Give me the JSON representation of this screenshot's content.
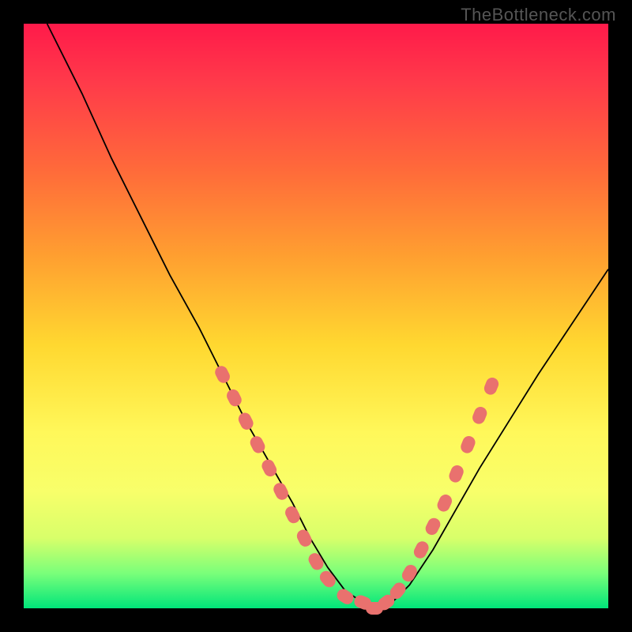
{
  "watermark": "TheBottleneck.com",
  "chart_data": {
    "type": "line",
    "title": "",
    "xlabel": "",
    "ylabel": "",
    "xlim": [
      0,
      100
    ],
    "ylim": [
      0,
      100
    ],
    "grid": false,
    "legend": false,
    "series": [
      {
        "name": "bottleneck-curve",
        "x": [
          4,
          10,
          15,
          20,
          25,
          30,
          34,
          38,
          42,
          46,
          49,
          52,
          55,
          58,
          60,
          63,
          66,
          70,
          74,
          78,
          83,
          88,
          94,
          100
        ],
        "y": [
          100,
          88,
          77,
          67,
          57,
          48,
          40,
          32,
          25,
          18,
          12,
          7,
          3,
          1,
          0,
          1,
          4,
          10,
          17,
          24,
          32,
          40,
          49,
          58
        ]
      }
    ],
    "markers": {
      "name": "highlighted-points",
      "points": [
        {
          "x": 34,
          "y": 40
        },
        {
          "x": 36,
          "y": 36
        },
        {
          "x": 38,
          "y": 32
        },
        {
          "x": 40,
          "y": 28
        },
        {
          "x": 42,
          "y": 24
        },
        {
          "x": 44,
          "y": 20
        },
        {
          "x": 46,
          "y": 16
        },
        {
          "x": 48,
          "y": 12
        },
        {
          "x": 50,
          "y": 8
        },
        {
          "x": 52,
          "y": 5
        },
        {
          "x": 55,
          "y": 2
        },
        {
          "x": 58,
          "y": 1
        },
        {
          "x": 60,
          "y": 0
        },
        {
          "x": 62,
          "y": 1
        },
        {
          "x": 64,
          "y": 3
        },
        {
          "x": 66,
          "y": 6
        },
        {
          "x": 68,
          "y": 10
        },
        {
          "x": 70,
          "y": 14
        },
        {
          "x": 72,
          "y": 18
        },
        {
          "x": 74,
          "y": 23
        },
        {
          "x": 76,
          "y": 28
        },
        {
          "x": 78,
          "y": 33
        },
        {
          "x": 80,
          "y": 38
        }
      ]
    },
    "background_gradient": {
      "top": "#ff1a4a",
      "upper_mid": "#ffa030",
      "mid": "#fff85a",
      "lower": "#00e57a"
    }
  }
}
